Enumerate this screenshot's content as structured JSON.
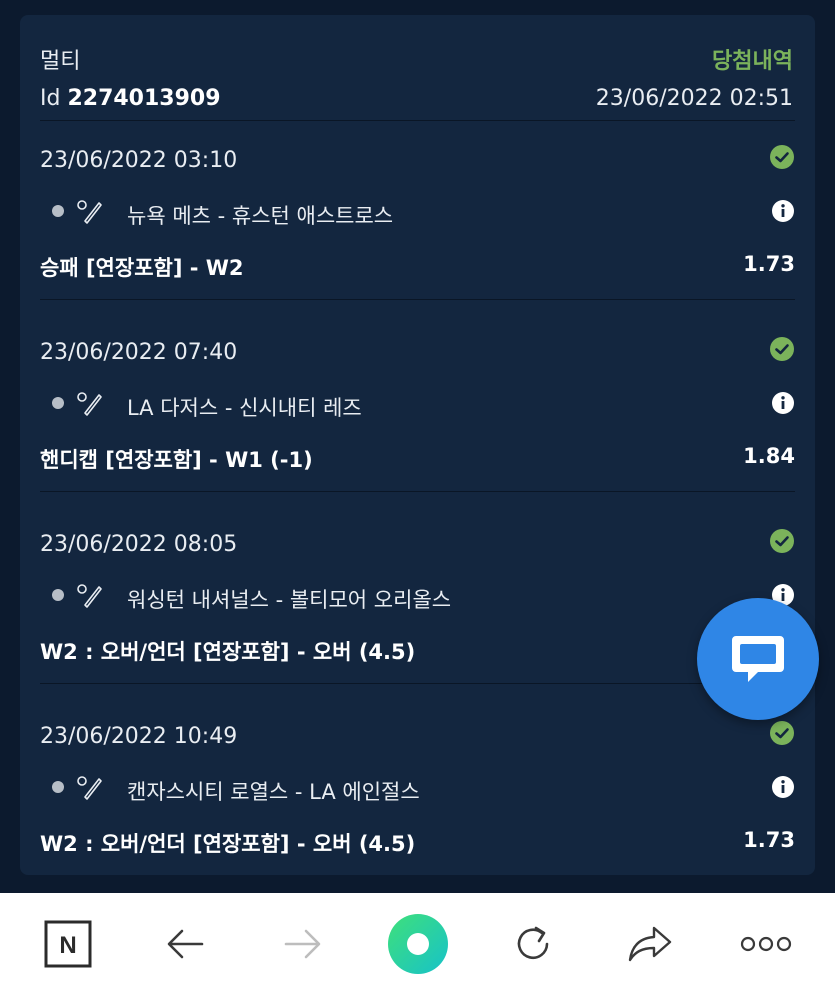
{
  "ticket": {
    "type": "멀티",
    "status": "당첨내역",
    "id_label": "Id",
    "id": "2274013909",
    "date": "23/06/2022 02:51"
  },
  "bets": [
    {
      "datetime": "23/06/2022 03:10",
      "teams": "뉴욕 메츠 - 휴스턴 애스트로스",
      "market": "승패 [연장포함] - W2",
      "odds": "1.73"
    },
    {
      "datetime": "23/06/2022 07:40",
      "teams": "LA 다저스 - 신시내티 레즈",
      "market": "핸디캡 [연장포함] - W1 (-1)",
      "odds": "1.84"
    },
    {
      "datetime": "23/06/2022 08:05",
      "teams": "워싱턴 내셔널스 - 볼티모어 오리올스",
      "market": "W2 : 오버/언더 [연장포함] - 오버 (4.5)",
      "odds": ""
    },
    {
      "datetime": "23/06/2022 10:49",
      "teams": "캔자스시티 로열스 - LA 에인절스",
      "market": "W2 : 오버/언더 [연장포함] - 오버 (4.5)",
      "odds": "1.73"
    }
  ],
  "colors": {
    "background": "#0c1a2e",
    "card": "#13263f",
    "win_green": "#7bb35b",
    "chat_blue": "#2f86e6"
  },
  "toolbar": {
    "items": [
      "naver-n-icon",
      "back-arrow-icon",
      "forward-arrow-icon",
      "home-circle-icon",
      "refresh-icon",
      "share-icon",
      "more-dots-icon"
    ],
    "n_label": "N"
  }
}
